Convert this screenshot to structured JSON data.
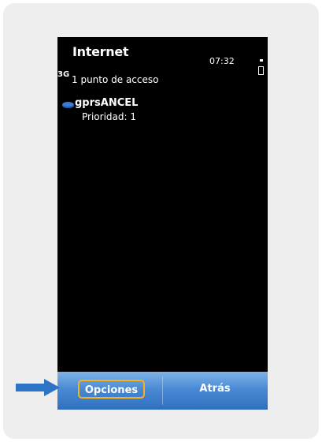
{
  "screen": {
    "title": "Internet",
    "clock": "07:32",
    "network_label": "3G",
    "subtitle": "1 punto de acceso"
  },
  "access_points": [
    {
      "name": "gprsANCEL",
      "detail": "Prioridad: 1",
      "icon": "connection-cloud-icon"
    }
  ],
  "softkeys": {
    "left_label": "Opciones",
    "right_label": "Atrás"
  },
  "colors": {
    "screen_background": "#000000",
    "softkey_bar": "#4a8ad3",
    "highlight_border": "#f6b21b",
    "arrow": "#2e74c4",
    "card_background": "#eeeeee"
  },
  "annotation": {
    "arrow_icon": "arrow-right-icon"
  }
}
